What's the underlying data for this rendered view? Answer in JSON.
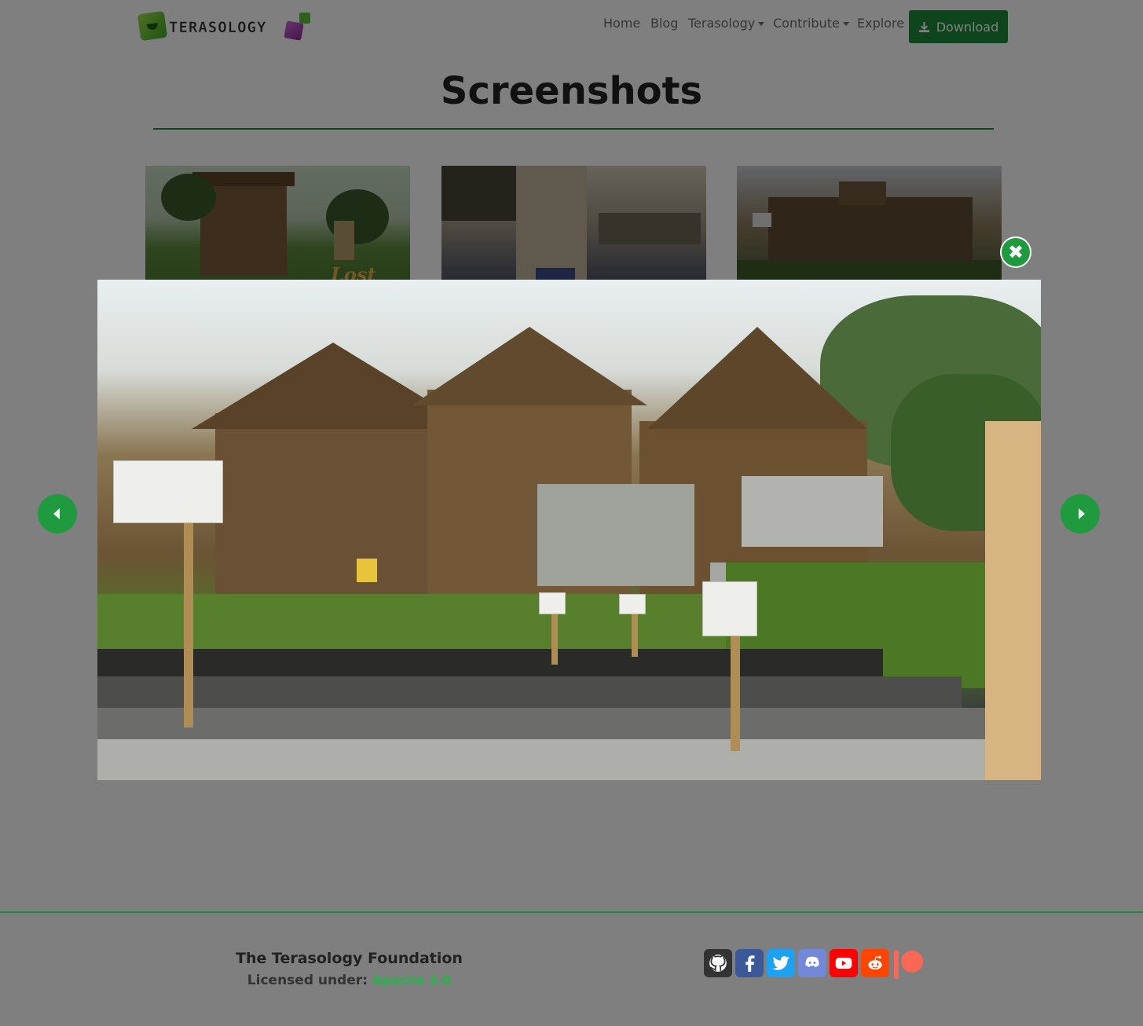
{
  "header": {
    "logo_text": "TERASOLOGY",
    "nav": [
      {
        "label": "Home"
      },
      {
        "label": "Blog"
      },
      {
        "label": "Terasology"
      },
      {
        "label": "Contribute"
      },
      {
        "label": "Explore"
      }
    ],
    "download_label": "Download"
  },
  "page": {
    "title": "Screenshots"
  },
  "thumbnails": [
    {
      "caption": "Lost"
    },
    {
      "caption": ""
    },
    {
      "caption": ""
    }
  ],
  "lightbox": {
    "close_icon": "close-icon",
    "prev_icon": "caret-left-icon",
    "next_icon": "caret-right-icon"
  },
  "footer": {
    "foundation": "The Terasology Foundation",
    "license_label": "Licensed under:",
    "license_link": "Apache 2.0",
    "socials": [
      {
        "icon": "github-icon",
        "color": "#333333"
      },
      {
        "icon": "facebook-icon",
        "color": "#3b5998"
      },
      {
        "icon": "twitter-icon",
        "color": "#1da1f2"
      },
      {
        "icon": "discord-icon",
        "color": "#7289da"
      },
      {
        "icon": "youtube-icon",
        "color": "#ff0000"
      },
      {
        "icon": "reddit-icon",
        "color": "#ff4500"
      },
      {
        "icon": "patreon-icon",
        "color": "#f96854"
      }
    ]
  },
  "colors": {
    "accent": "#1f8a3a",
    "overlay": "rgba(0,0,0,0.5)"
  }
}
